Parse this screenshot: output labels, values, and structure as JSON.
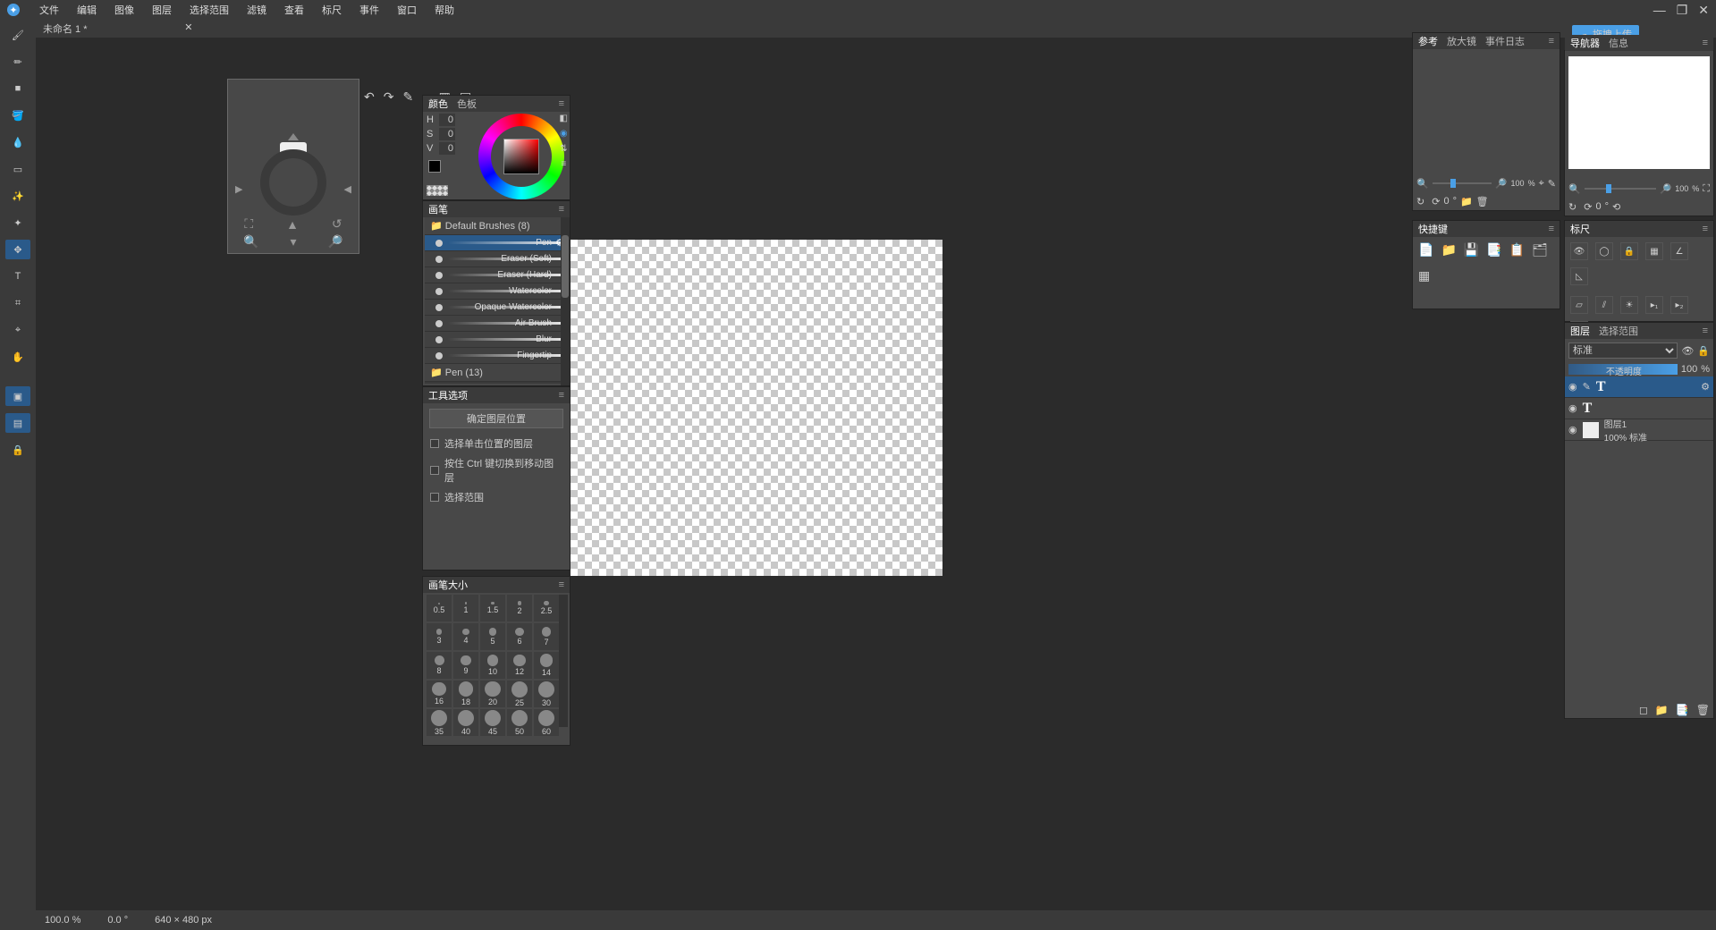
{
  "menu": {
    "file": "文件",
    "edit": "编辑",
    "image": "图像",
    "layer": "图层",
    "select": "选择范围",
    "filter": "滤镜",
    "view": "查看",
    "scale": "标尺",
    "event": "事件",
    "window": "窗口",
    "help": "帮助"
  },
  "window_controls": {
    "min": "—",
    "max": "❐",
    "close": "✕"
  },
  "doc": {
    "name": "未命名 1 *",
    "close": "✕"
  },
  "tools": [
    "brush",
    "pencil",
    "rect",
    "fill",
    "watercolor",
    "marquee",
    "wand",
    "sparkle",
    "move",
    "text",
    "crop",
    "eyedropper",
    "hand"
  ],
  "tool_icons": {
    "brush": "🖌",
    "pencil": "✏",
    "rect": "■",
    "fill": "🪣",
    "watercolor": "💧",
    "marquee": "▭",
    "wand": "✨",
    "sparkle": "✦",
    "move": "✥",
    "text": "T",
    "crop": "⌗",
    "eyedropper": "⌖",
    "hand": "✋",
    "boxed1": "▣",
    "boxed2": "▤",
    "lock": "🔒"
  },
  "nav_popup": {
    "center": "○",
    "zoom_in": "🔍+",
    "zoom_out": "🔍-",
    "fit": "⛶",
    "reset": "↺",
    "down": "▼",
    "up": "▲",
    "left": "◀",
    "right": "▶"
  },
  "top_tool_row": {
    "undo": "↶",
    "redo": "↷",
    "brush": "✎",
    "shape": "○",
    "fill": "▦",
    "grid": "▤"
  },
  "color": {
    "tab1": "颜色",
    "tab2": "色板",
    "H": "H",
    "S": "S",
    "V": "V",
    "Hv": "0",
    "Sv": "0",
    "Vv": "0"
  },
  "brush": {
    "title": "画笔",
    "group": "Default Brushes (8)",
    "items": [
      "Pen",
      "Eraser (Soft)",
      "Eraser (Hard)",
      "Watercolor",
      "Opaque Watercolor",
      "Air Brush",
      "Blur",
      "Fingertip"
    ],
    "group2": "Pen (13)"
  },
  "options": {
    "title": "工具选项",
    "btn": "确定图层位置",
    "c1": "选择单击位置的图层",
    "c2": "按住 Ctrl 键切换到移动图层",
    "c3": "选择范围"
  },
  "size": {
    "title": "画笔大小",
    "values": [
      "0.5",
      "1",
      "1.5",
      "2",
      "2.5",
      "3",
      "4",
      "5",
      "6",
      "7",
      "8",
      "9",
      "10",
      "12",
      "14",
      "16",
      "18",
      "20",
      "25",
      "30",
      "35",
      "40",
      "45",
      "50",
      "60"
    ]
  },
  "ref": {
    "tab1": "参考",
    "tab2": "放大镜",
    "tab3": "事件日志"
  },
  "navprev": {
    "tab1": "导航器",
    "tab2": "信息",
    "zoom": "100",
    "pct": "%",
    "angle": "0",
    "deg": "°"
  },
  "shortcut": {
    "title": "快捷键"
  },
  "ruler": {
    "title": "标尺"
  },
  "upload": "拖拽上传",
  "layer": {
    "tab1": "图层",
    "tab2": "选择范围",
    "mode": "标准",
    "opacity_label": "不透明度",
    "opacity": "100",
    "pct": "%",
    "layers": [
      {
        "name": "",
        "type": "T",
        "active": true
      },
      {
        "name": "",
        "type": "T",
        "active": false
      },
      {
        "name": "图层1",
        "sub": "100% 标准",
        "type": "img",
        "active": false
      }
    ]
  },
  "status": {
    "zoom": "100.0 %",
    "angle": "0.0 °",
    "dim": "640 × 480 px"
  }
}
